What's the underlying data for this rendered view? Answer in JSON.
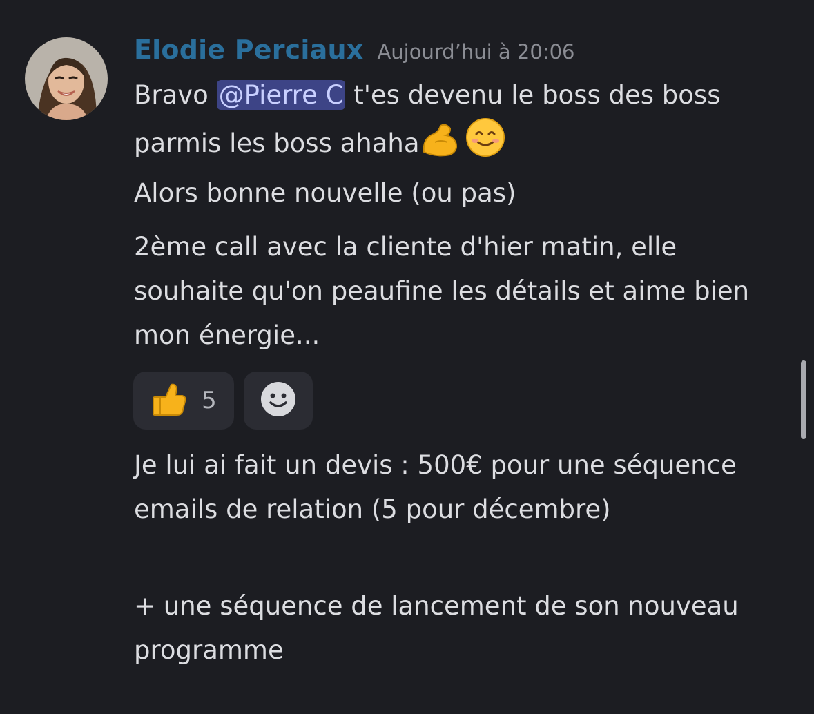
{
  "message": {
    "author": "Elodie Perciaux",
    "timestamp": "Aujourd’hui à 20:06",
    "author_color": "#2a6f9c",
    "paragraphs": {
      "p1_before": "Bravo ",
      "p1_mention": "@Pierre C",
      "p1_after": " t'es devenu le boss des boss parmis les boss ahaha",
      "p2": "Alors bonne nouvelle (ou pas)",
      "p3": "2ème call avec la cliente d'hier matin, elle souhaite qu'on peaufine les détails et aime bien mon énergie...",
      "p4": "Je lui ai fait un devis : 500€ pour une séquence emails de relation (5 pour décembre)",
      "p5": "+ une séquence de lancement de son nouveau programme"
    },
    "inline_emojis": [
      "flexed-biceps-icon",
      "smiling-face-icon"
    ]
  },
  "reactions": [
    {
      "icon": "thumbs-up-icon",
      "count": "5"
    },
    {
      "icon": "add-reaction-icon"
    }
  ],
  "colors": {
    "background": "#1c1d22",
    "text": "#dcdde1",
    "mention_bg": "#3d4486",
    "mention_text": "#c9d0ff",
    "reaction_bg": "#2b2c33",
    "timestamp": "#8b8d94"
  }
}
